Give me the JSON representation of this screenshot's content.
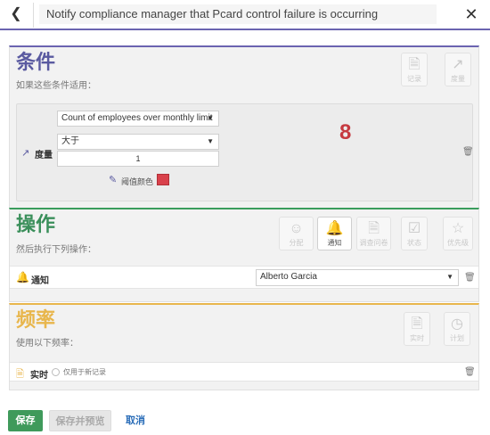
{
  "header": {
    "back_icon": "chevron-left-icon",
    "title": "Notify compliance manager that Pcard control failure is occurring",
    "close_icon": "close-icon"
  },
  "conditions": {
    "title": "条件",
    "subtitle": "如果这些条件适用：",
    "accent": "#6b64b0",
    "tools": [
      {
        "icon": "document-icon",
        "label": "记录"
      },
      {
        "icon": "trend-icon",
        "label": "度量"
      }
    ],
    "metric_label": "度量",
    "metric_select": "Count of employees over monthly limit",
    "operator_select": "大于",
    "threshold_value": "1",
    "threshold_color_label": "阈值颜色",
    "threshold_color": "#d9414b",
    "current_value": "8"
  },
  "actions": {
    "title": "操作",
    "subtitle": "然后执行下列操作：",
    "accent": "#3a9d5d",
    "tools": [
      {
        "icon": "person-icon",
        "label": "分配"
      },
      {
        "icon": "bell-icon",
        "label": "通知"
      },
      {
        "icon": "survey-icon",
        "label": "调查问卷"
      },
      {
        "icon": "status-icon",
        "label": "状态"
      },
      {
        "icon": "star-icon",
        "label": "优先级"
      }
    ],
    "notify_label": "通知",
    "notify_select": "Alberto Garcia"
  },
  "frequency": {
    "title": "频率",
    "subtitle": "使用以下频率：",
    "accent": "#e8b64c",
    "tools": [
      {
        "icon": "realtime-icon",
        "label": "实时"
      },
      {
        "icon": "clock-icon",
        "label": "计划"
      }
    ],
    "realtime_label": "实时",
    "new_records_label": "仅用于新记录"
  },
  "footer": {
    "save_label": "保存",
    "save_preview_label": "保存并预览",
    "cancel_label": "取消"
  }
}
